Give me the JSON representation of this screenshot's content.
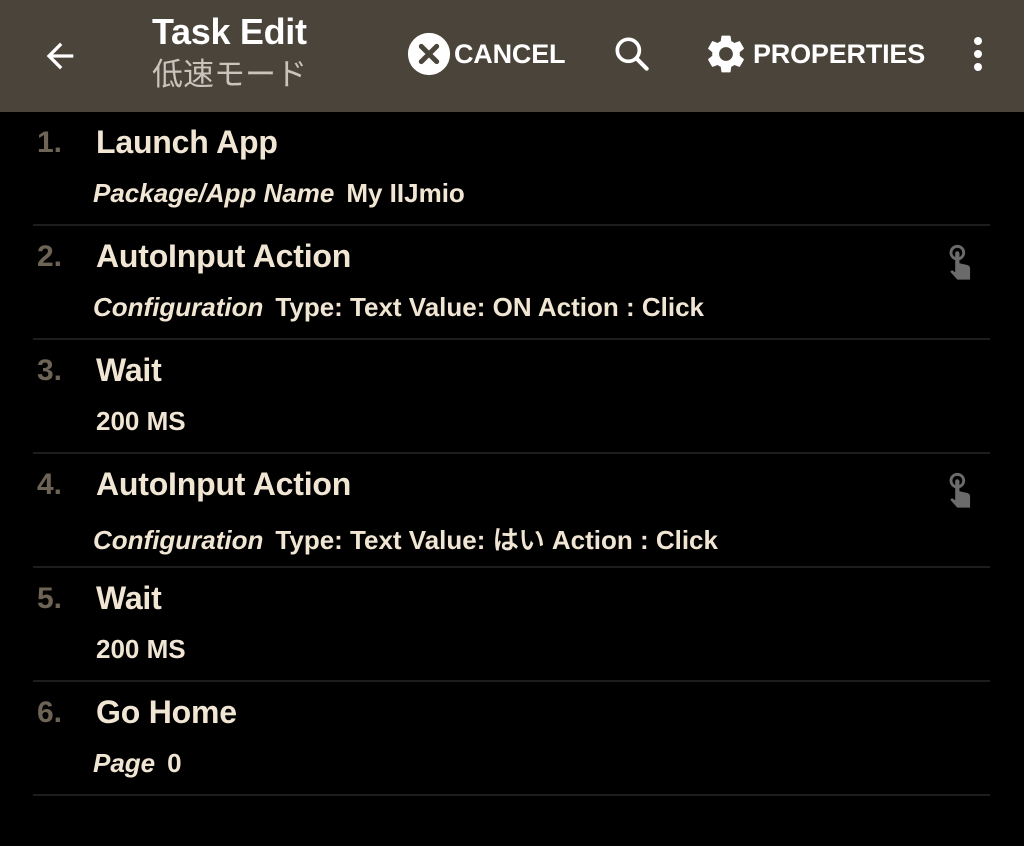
{
  "appbar": {
    "title": "Task Edit",
    "subtitle": "低速モード",
    "back_icon": "arrow-left-icon",
    "cancel_label": "CANCEL",
    "cancel_icon": "close-circle-icon",
    "search_icon": "search-icon",
    "properties_label": "PROPERTIES",
    "properties_icon": "gear-icon",
    "more_icon": "more-vert-icon",
    "background": "#4b443a"
  },
  "actions": [
    {
      "number": "1.",
      "name": "Launch App",
      "param_label": "Package/App Name",
      "param_value": "My IIJmio",
      "has_touch_icon": false
    },
    {
      "number": "2.",
      "name": "AutoInput Action",
      "param_label": "Configuration",
      "param_value": "Type: Text Value: ON Action : Click",
      "has_touch_icon": true
    },
    {
      "number": "3.",
      "name": "Wait",
      "param_label": "",
      "param_value": "200 MS",
      "has_touch_icon": false
    },
    {
      "number": "4.",
      "name": "AutoInput Action",
      "param_label": "Configuration",
      "param_value": "Type: Text Value: はい Action : Click",
      "has_touch_icon": true
    },
    {
      "number": "5.",
      "name": "Wait",
      "param_label": "",
      "param_value": "200 MS",
      "has_touch_icon": false
    },
    {
      "number": "6.",
      "name": "Go Home",
      "param_label": "Page",
      "param_value": "0",
      "has_touch_icon": false
    }
  ],
  "colors": {
    "text": "#f1e6d3",
    "number": "#6d6456",
    "divider": "#1d1d1d",
    "touch_icon": "#6b6b6b"
  }
}
